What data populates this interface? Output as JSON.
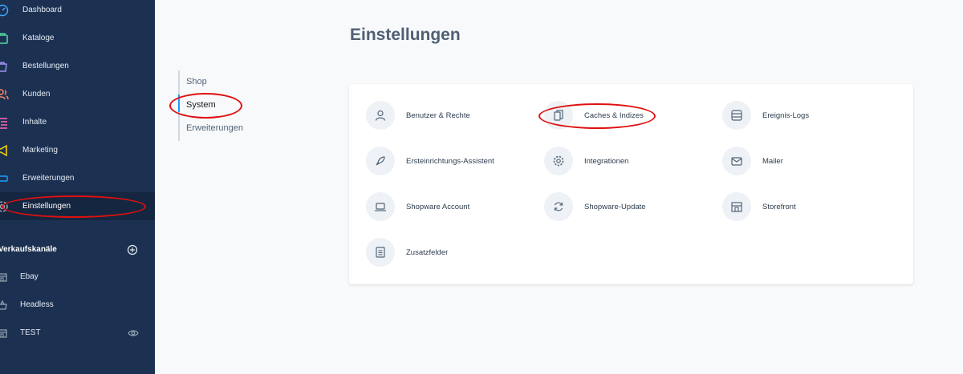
{
  "sidebar": {
    "items": [
      {
        "label": "Dashboard",
        "icon": "dashboard-icon",
        "color": "#3fa8ff"
      },
      {
        "label": "Kataloge",
        "icon": "catalog-icon",
        "color": "#57d9a3"
      },
      {
        "label": "Bestellungen",
        "icon": "orders-icon",
        "color": "#a092f0"
      },
      {
        "label": "Kunden",
        "icon": "customers-icon",
        "color": "#f88962"
      },
      {
        "label": "Inhalte",
        "icon": "content-icon",
        "color": "#ff68b4"
      },
      {
        "label": "Marketing",
        "icon": "marketing-icon",
        "color": "#ffd700"
      },
      {
        "label": "Erweiterungen",
        "icon": "extensions-icon",
        "color": "#189eff"
      },
      {
        "label": "Einstellungen",
        "icon": "settings-icon",
        "color": "#9aa8b5"
      }
    ],
    "sales_channels_title": "Verkaufskanäle",
    "channels": [
      {
        "label": "Ebay",
        "icon": "storefront-icon"
      },
      {
        "label": "Headless",
        "icon": "basket-icon"
      },
      {
        "label": "TEST",
        "icon": "storefront-icon"
      }
    ]
  },
  "main": {
    "title": "Einstellungen",
    "tabs": [
      "Shop",
      "System",
      "Erweiterungen"
    ],
    "active_tab": "System",
    "tiles": [
      {
        "label": "Benutzer & Rechte",
        "icon": "user-icon"
      },
      {
        "label": "Caches & Indizes",
        "icon": "copy-icon"
      },
      {
        "label": "Ereignis-Logs",
        "icon": "server-icon"
      },
      {
        "label": "Ersteinrichtungs-Assistent",
        "icon": "rocket-icon"
      },
      {
        "label": "Integrationen",
        "icon": "gear-icon"
      },
      {
        "label": "Mailer",
        "icon": "envelope-icon"
      },
      {
        "label": "Shopware Account",
        "icon": "laptop-icon"
      },
      {
        "label": "Shopware-Update",
        "icon": "refresh-icon"
      },
      {
        "label": "Storefront",
        "icon": "storefront-icon"
      },
      {
        "label": "Zusatzfelder",
        "icon": "document-list-icon"
      }
    ]
  },
  "colors": {
    "sidebar_bg": "#1c3152",
    "annotation": "#e01010",
    "accent": "#189eff"
  }
}
